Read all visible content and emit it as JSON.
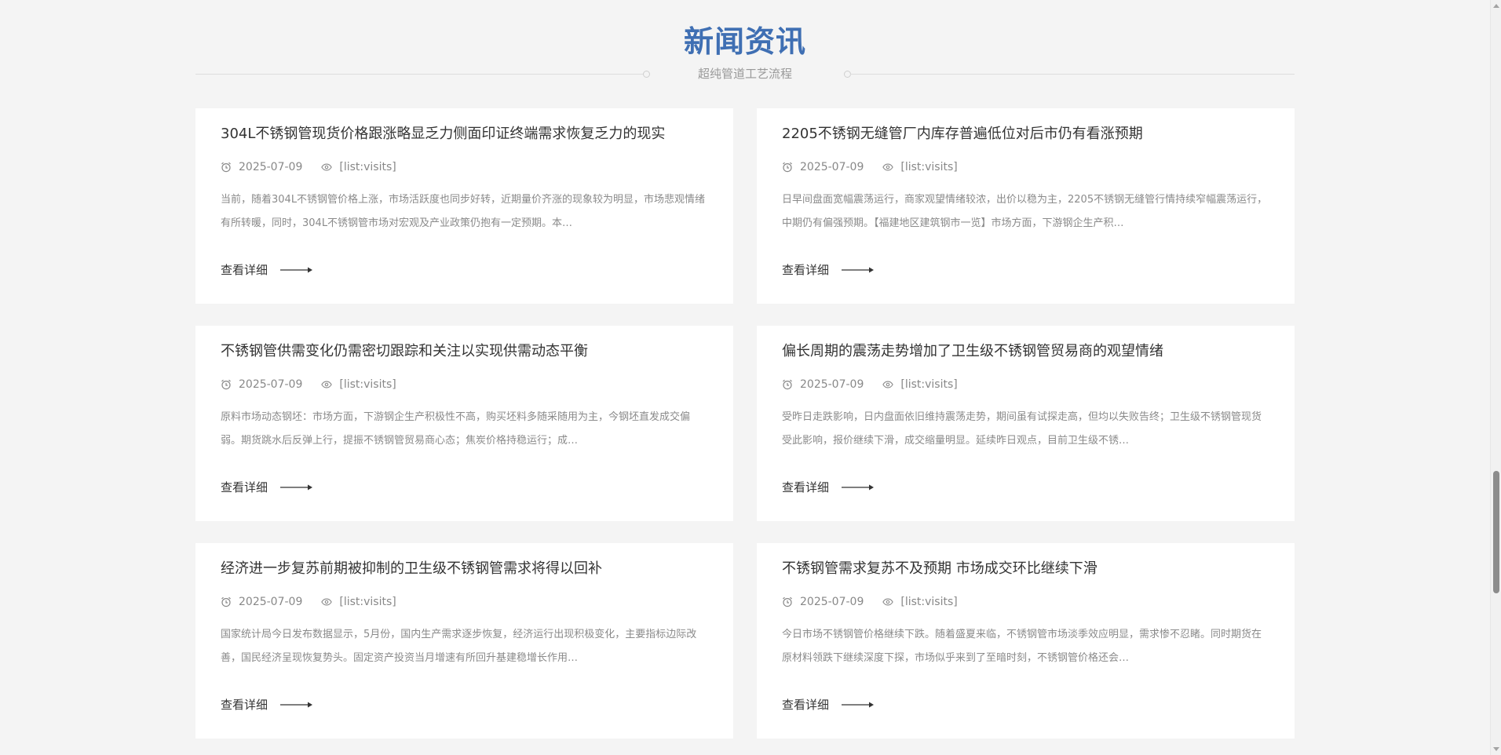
{
  "colors": {
    "title": "#3f6fb3",
    "background": "#f4f4f4",
    "card": "#ffffff"
  },
  "section": {
    "title": "新闻资讯",
    "subtitle": "超纯管道工艺流程"
  },
  "news": [
    {
      "title": "304L不锈钢管现货价格跟涨略显乏力侧面印证终端需求恢复乏力的现实",
      "date": "2025-07-09",
      "visits": "[list:visits]",
      "excerpt": "当前，随着304L不锈钢管价格上涨，市场活跃度也同步好转，近期量价齐涨的现象较为明显，市场悲观情绪有所转暖，同时，304L不锈钢管市场对宏观及产业政策仍抱有一定预期。本…",
      "link": "查看详细"
    },
    {
      "title": "2205不锈钢无缝管厂内库存普遍低位对后市仍有看涨预期",
      "date": "2025-07-09",
      "visits": "[list:visits]",
      "excerpt": "日早间盘面宽幅震荡运行，商家观望情绪较浓，出价以稳为主，2205不锈钢无缝管行情持续窄幅震荡运行，中期仍有偏强预期。【福建地区建筑钢市一览】市场方面，下游钢企生产积…",
      "link": "查看详细"
    },
    {
      "title": "不锈钢管供需变化仍需密切跟踪和关注以实现供需动态平衡",
      "date": "2025-07-09",
      "visits": "[list:visits]",
      "excerpt": "原料市场动态钢坯：市场方面，下游钢企生产积极性不高，购买坯料多随采随用为主，今钢坯直发成交偏弱。期货跳水后反弹上行，提振不锈钢管贸易商心态；焦炭价格持稳运行；成…",
      "link": "查看详细"
    },
    {
      "title": "偏长周期的震荡走势增加了卫生级不锈钢管贸易商的观望情绪",
      "date": "2025-07-09",
      "visits": "[list:visits]",
      "excerpt": "受昨日走跌影响，日内盘面依旧维持震荡走势，期间虽有试探走高，但均以失败告终；卫生级不锈钢管现货受此影响，报价继续下滑，成交缩量明显。延续昨日观点，目前卫生级不锈…",
      "link": "查看详细"
    },
    {
      "title": "经济进一步复苏前期被抑制的卫生级不锈钢管需求将得以回补",
      "date": "2025-07-09",
      "visits": "[list:visits]",
      "excerpt": "国家统计局今日发布数据显示，5月份，国内生产需求逐步恢复，经济运行出现积极变化，主要指标边际改善，国民经济呈现恢复势头。固定资产投资当月增速有所回升基建稳增长作用…",
      "link": "查看详细"
    },
    {
      "title": "不锈钢管需求复苏不及预期 市场成交环比继续下滑",
      "date": "2025-07-09",
      "visits": "[list:visits]",
      "excerpt": "今日市场不锈钢管价格继续下跌。随着盛夏来临，不锈钢管市场淡季效应明显，需求惨不忍睹。同时期货在原材料领跌下继续深度下探，市场似乎来到了至暗时刻，不锈钢管价格还会…",
      "link": "查看详细"
    }
  ]
}
